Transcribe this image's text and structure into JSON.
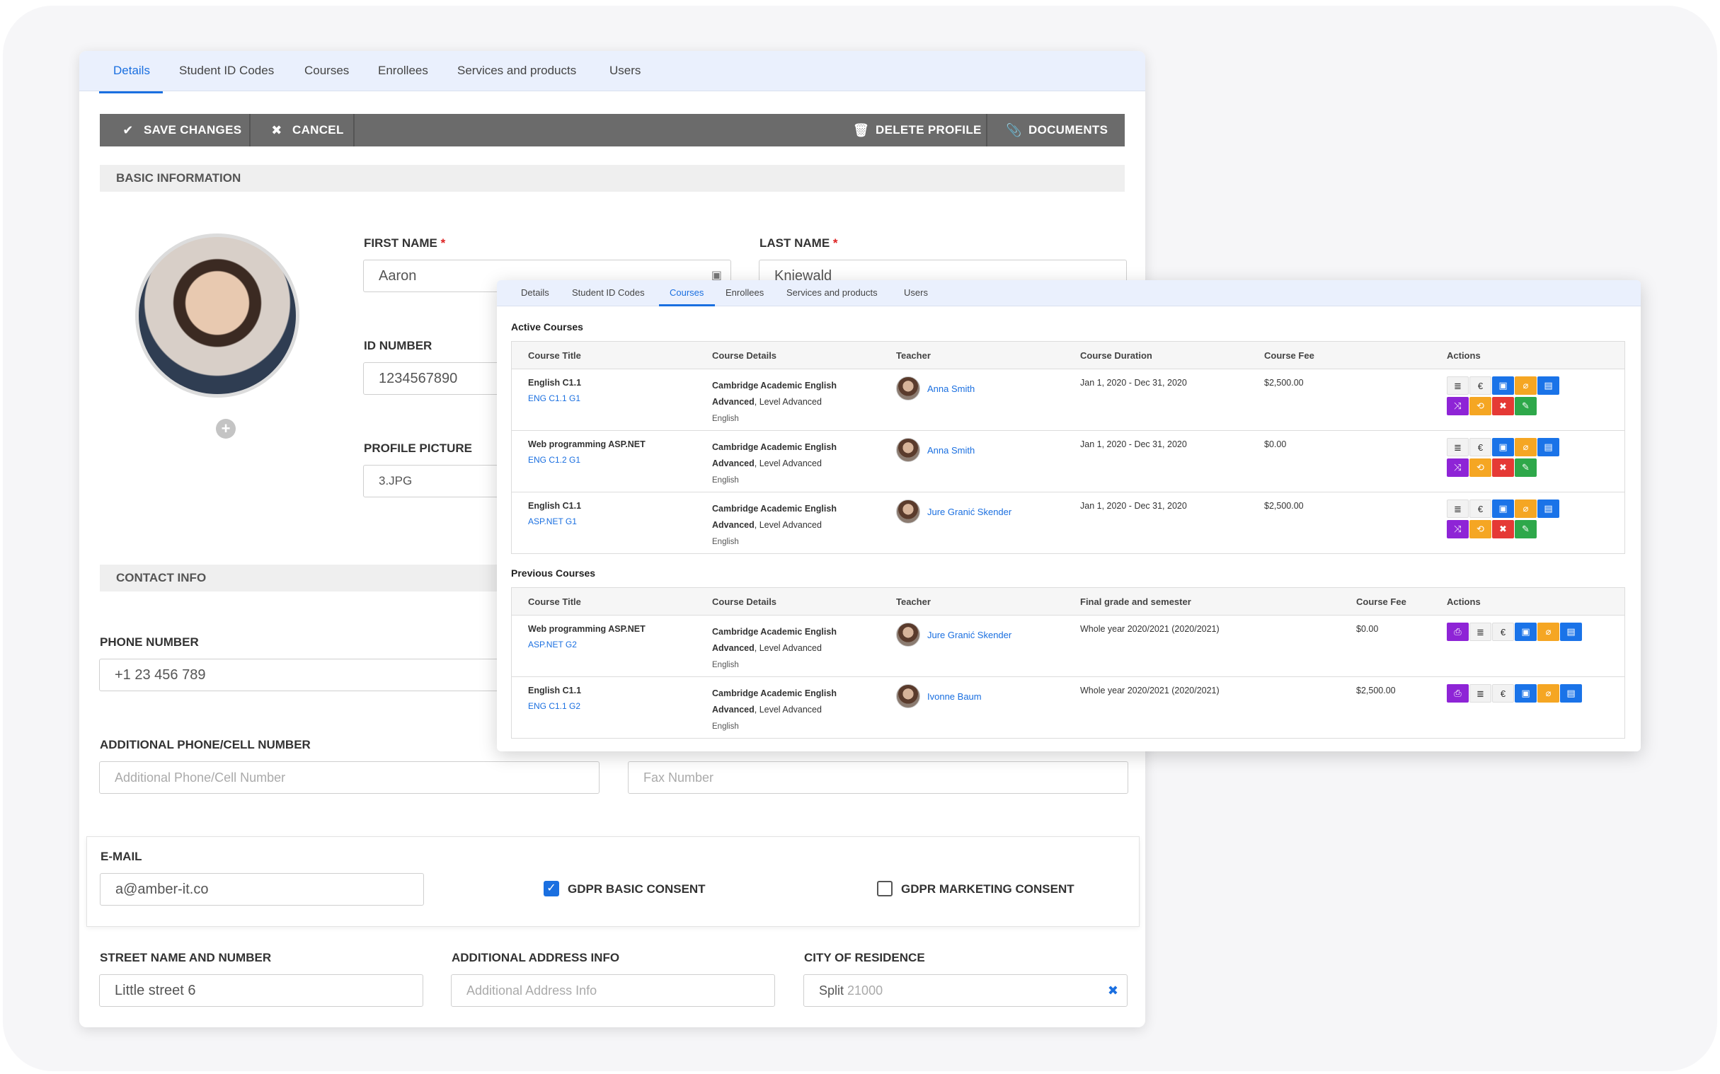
{
  "back": {
    "tabs": [
      "Details",
      "Student ID Codes",
      "Courses",
      "Enrollees",
      "Services and products",
      "Users"
    ],
    "toolbar": {
      "save": "SAVE CHANGES",
      "cancel": "CANCEL",
      "delete": "DELETE PROFILE",
      "documents": "DOCUMENTS"
    },
    "basic_info": "BASIC INFORMATION",
    "first_name_label": "FIRST NAME",
    "first_name_value": "Aaron",
    "last_name_label": "LAST NAME",
    "last_name_value": "Kniewald",
    "required_mark": "*",
    "id_number_label": "ID NUMBER",
    "id_number_value": "1234567890",
    "profile_picture_label": "PROFILE PICTURE",
    "profile_picture_value": "3.JPG",
    "contact_info": "CONTACT INFO",
    "phone_label": "PHONE NUMBER",
    "phone_value": "+1 23 456 789",
    "additional_phone_label": "ADDITIONAL PHONE/CELL NUMBER",
    "additional_phone_placeholder": "Additional Phone/Cell Number",
    "fax_placeholder": "Fax Number",
    "email_label": "E-MAIL",
    "email_value": "a@amber-it.co",
    "gdpr_basic": "GDPR BASIC CONSENT",
    "gdpr_marketing": "GDPR MARKETING CONSENT",
    "street_label": "STREET NAME AND NUMBER",
    "street_value": "Little street 6",
    "additional_address_label": "ADDITIONAL ADDRESS INFO",
    "additional_address_placeholder": "Additional Address Info",
    "city_label": "CITY OF RESIDENCE",
    "city_value": "Split",
    "city_zip": "21000"
  },
  "front": {
    "tabs": [
      "Details",
      "Student ID Codes",
      "Courses",
      "Enrollees",
      "Services and products",
      "Users"
    ],
    "active_title": "Active Courses",
    "active_headers": [
      "Course Title",
      "Course Details",
      "Teacher",
      "Course Duration",
      "Course Fee",
      "Actions"
    ],
    "active_rows": [
      {
        "title": "English C1.1",
        "code": "ENG C1.1 G1",
        "details_bold": "Cambridge Academic English",
        "level_bold": "Advanced",
        "level_rest": ", Level Advanced",
        "lang": "English",
        "teacher": "Anna Smith",
        "duration": "Jan 1, 2020 - Dec 31, 2020",
        "fee": "$2,500.00"
      },
      {
        "title": "Web programming ASP.NET",
        "code": "ENG C1.2 G1",
        "details_bold": "Cambridge Academic English",
        "level_bold": "Advanced",
        "level_rest": ", Level Advanced",
        "lang": "English",
        "teacher": "Anna Smith",
        "duration": "Jan 1, 2020 - Dec 31, 2020",
        "fee": "$0.00"
      },
      {
        "title": "English C1.1",
        "code": "ASP.NET G1",
        "details_bold": "Cambridge Academic English",
        "level_bold": "Advanced",
        "level_rest": ", Level Advanced",
        "lang": "English",
        "teacher": "Jure Granić Skender",
        "duration": "Jan 1, 2020 - Dec 31, 2020",
        "fee": "$2,500.00"
      }
    ],
    "previous_title": "Previous Courses",
    "previous_headers": [
      "Course Title",
      "Course Details",
      "Teacher",
      "Final grade and semester",
      "Course Fee",
      "Actions"
    ],
    "previous_rows": [
      {
        "title": "Web programming ASP.NET",
        "code": "ASP.NET G2",
        "details_bold": "Cambridge Academic English",
        "level_bold": "Advanced",
        "level_rest": ", Level Advanced",
        "lang": "English",
        "teacher": "Jure Granić Skender",
        "grade": "Whole year 2020/2021 (2020/2021)",
        "fee": "$0.00"
      },
      {
        "title": "English C1.1",
        "code": "ENG C1.1 G2",
        "details_bold": "Cambridge Academic English",
        "level_bold": "Advanced",
        "level_rest": ", Level Advanced",
        "lang": "English",
        "teacher": "Ivonne Baum",
        "grade": "Whole year 2020/2021 (2020/2021)",
        "fee": "$2,500.00"
      }
    ],
    "euro_symbol": "€"
  },
  "colors": {
    "accent": "#1a6fe0",
    "toolbar": "#6b6b6b",
    "tab_bar": "#eaf0fd",
    "action_blue": "#1a73e8",
    "action_orange": "#f5a623",
    "action_purple": "#8e24d6",
    "action_red": "#e53935",
    "action_green": "#2ea84a"
  }
}
